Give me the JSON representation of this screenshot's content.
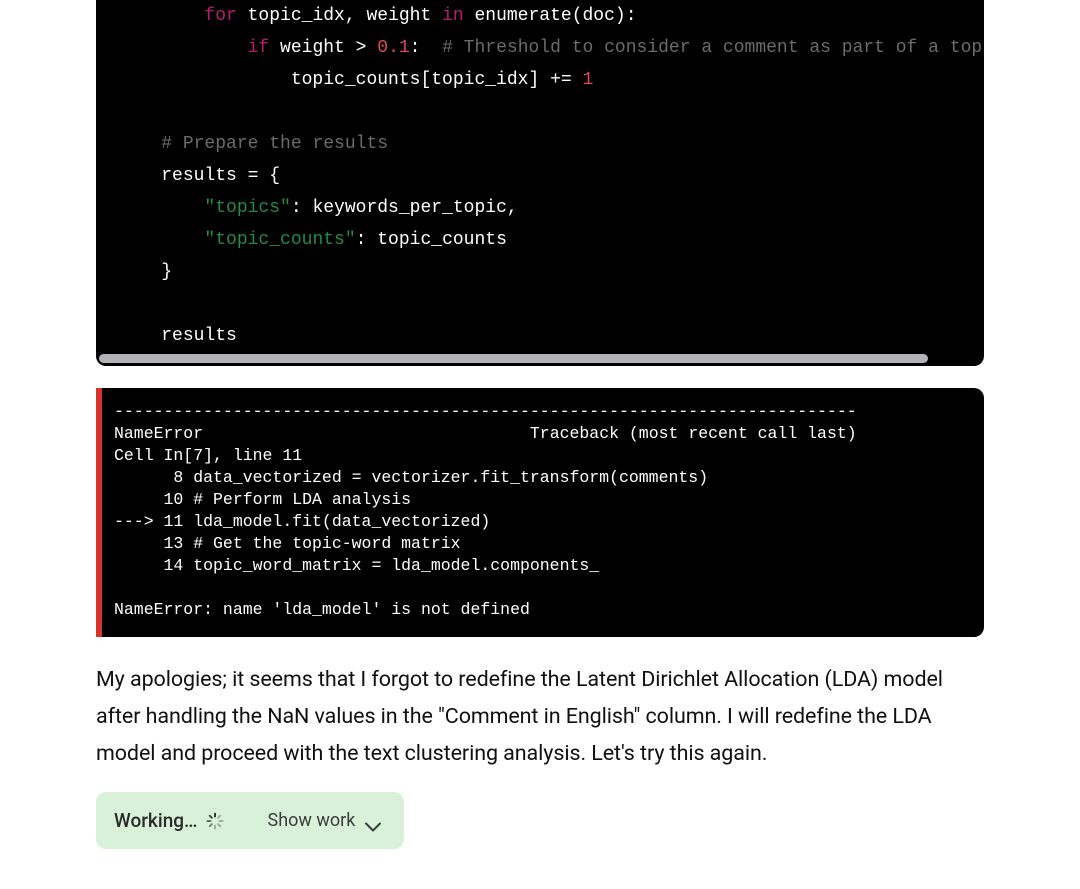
{
  "code": {
    "l1_indent": "        ",
    "l1_kw": "for",
    "l1_rest1": " topic_idx, weight ",
    "l1_kw2": "in",
    "l1_rest2": " enumerate(doc):",
    "l2_indent": "            ",
    "l2_kw": "if",
    "l2_rest1": " weight > ",
    "l2_num": "0.1",
    "l2_rest2": ":  ",
    "l2_comment": "# Threshold to consider a comment as part of a top",
    "l3_indent": "                ",
    "l3_rest1": "topic_counts[topic_idx] += ",
    "l3_num": "1",
    "l4": "",
    "l5_indent": "    ",
    "l5_comment": "# Prepare the results",
    "l6_indent": "    ",
    "l6_rest": "results = {",
    "l7_indent": "        ",
    "l7_str": "\"topics\"",
    "l7_rest": ": keywords_per_topic,",
    "l8_indent": "        ",
    "l8_str": "\"topic_counts\"",
    "l8_rest": ": topic_counts",
    "l9_indent": "    ",
    "l9_rest": "}",
    "l10": "",
    "l11_indent": "    ",
    "l11_rest": "results"
  },
  "error": {
    "sep": "---------------------------------------------------------------------------",
    "name": "NameError",
    "spaces": "                                 ",
    "trace": "Traceback (most recent call last)",
    "cell": "Cell In[7], line 11",
    "l8": "      8 data_vectorized = vectorizer.fit_transform(comments)",
    "l10": "     10 # Perform LDA analysis",
    "l11": "---> 11 lda_model.fit(data_vectorized)",
    "l13": "     13 # Get the topic-word matrix",
    "l14": "     14 topic_word_matrix = lda_model.components_",
    "blank": "",
    "msg": "NameError: name 'lda_model' is not defined"
  },
  "assistant_text": "My apologies; it seems that I forgot to redefine the Latent Dirichlet Allocation (LDA) model after handling the NaN values in the \"Comment in English\" column. I will redefine the LDA model and proceed with the text clustering analysis. Let's try this again.",
  "status": {
    "working": "Working…",
    "show_work": "Show work"
  }
}
